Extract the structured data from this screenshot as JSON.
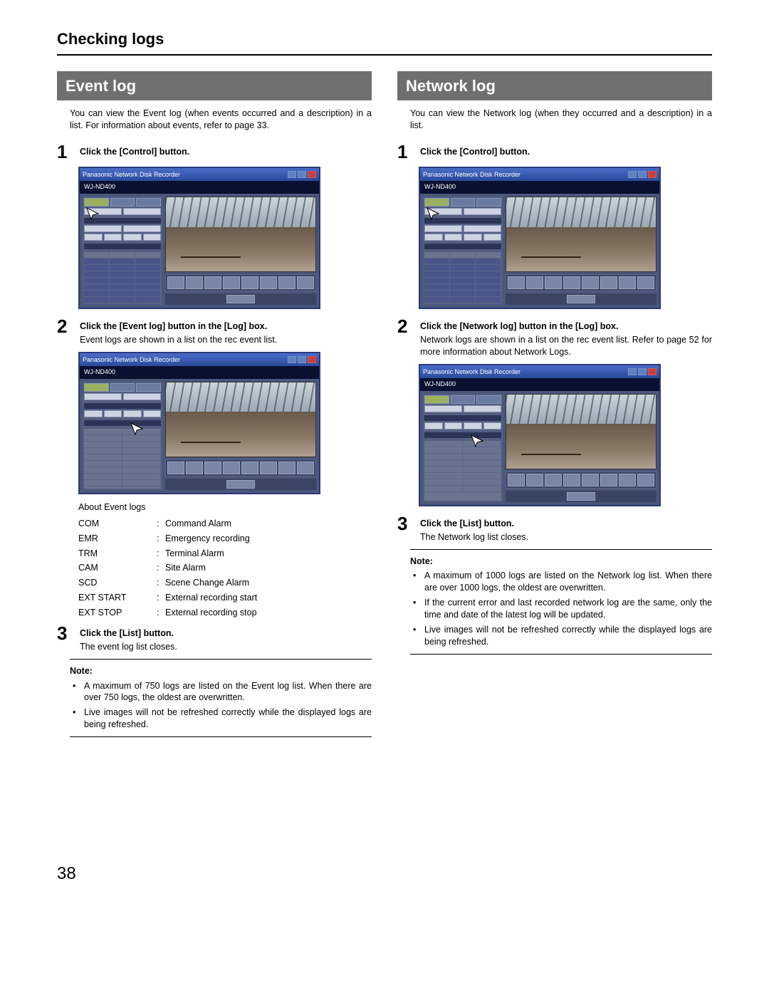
{
  "page_title": "Checking logs",
  "page_number": "38",
  "left": {
    "header": "Event log",
    "intro": "You can view the Event log (when events occurred and a description) in a list. For information about events, refer to page 33.",
    "step1_head": "Click the [Control] button.",
    "step2_head": "Click the [Event log] button in the [Log] box.",
    "step2_desc": "Event logs are shown in a list on the rec event list.",
    "about_caption": "About Event logs",
    "defs": [
      {
        "k": "COM",
        "v": "Command Alarm"
      },
      {
        "k": "EMR",
        "v": "Emergency recording"
      },
      {
        "k": "TRM",
        "v": "Terminal Alarm"
      },
      {
        "k": "CAM",
        "v": "Site Alarm"
      },
      {
        "k": "SCD",
        "v": "Scene Change Alarm"
      },
      {
        "k": "EXT START",
        "v": "External recording start"
      },
      {
        "k": "EXT STOP",
        "v": "External recording stop"
      }
    ],
    "step3_head": "Click the [List] button.",
    "step3_desc": "The event log list closes.",
    "note_label": "Note:",
    "notes": [
      "A maximum of 750 logs are listed on the Event log list. When there are over 750 logs, the oldest are overwritten.",
      "Live images will not be refreshed correctly while the displayed logs are being refreshed."
    ]
  },
  "right": {
    "header": "Network log",
    "intro": "You can view the Network log (when they occurred and a description) in a list.",
    "step1_head": "Click the [Control] button.",
    "step2_head": "Click the [Network log] button in the [Log] box.",
    "step2_desc": "Network logs are shown in a list on the rec event list. Refer to page 52 for more information about Network Logs.",
    "step3_head": "Click the [List] button.",
    "step3_desc": "The Network log list closes.",
    "note_label": "Note:",
    "notes": [
      "A maximum of 1000 logs are listed on the Network log list. When there are over 1000 logs, the oldest are overwritten.",
      "If the current error and last recorded network log are the same, only the time and date of the latest log will be updated.",
      "Live images will not be refreshed correctly while the displayed logs are being refreshed."
    ]
  },
  "shot": {
    "title_model": "WJ-ND400"
  }
}
